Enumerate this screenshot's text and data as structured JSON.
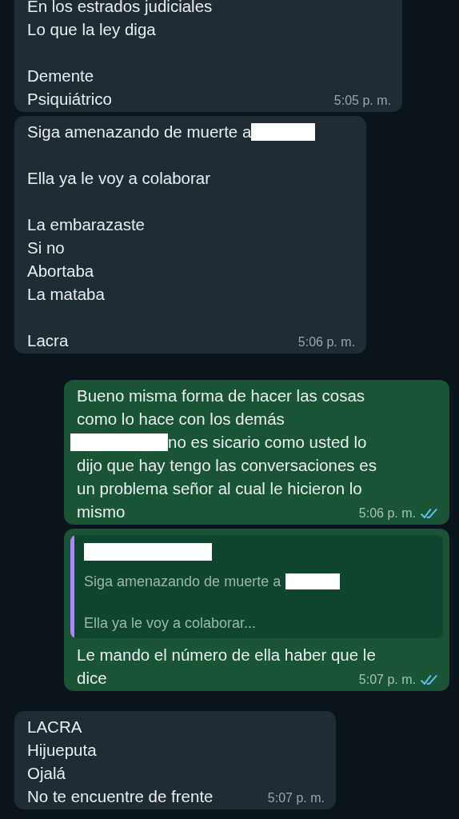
{
  "messages": [
    {
      "kind": "incoming",
      "paragraphs": [
        [
          {
            "text": "En los estrados judiciales"
          },
          {
            "text": "Lo que la ley diga"
          }
        ],
        [
          {
            "text": "Demente"
          },
          {
            "text": "Psiquiátrico"
          }
        ]
      ],
      "time": "5:05 p. m."
    },
    {
      "kind": "incoming",
      "paragraphs": [
        [
          {
            "text": "Siga amenazando de muerte a",
            "redacted_after": true
          }
        ],
        [
          {
            "text": "Ella ya le voy a colaborar"
          }
        ],
        [
          {
            "text": "La embarazaste"
          },
          {
            "text": "Si no"
          },
          {
            "text": "Abortaba"
          },
          {
            "text": "La mataba"
          }
        ],
        [
          {
            "text": "Lacra"
          }
        ]
      ],
      "time": "5:06 p. m."
    },
    {
      "kind": "outgoing",
      "paragraphs": [
        [
          {
            "text": "Bueno misma forma de hacer las cosas"
          },
          {
            "text": "como lo hace con los demás"
          },
          {
            "text": "no es sicario como usted lo",
            "redacted_before": true
          },
          {
            "text": "dijo que hay tengo las conversaciones es"
          },
          {
            "text": "un problema señor al cual le hicieron lo"
          },
          {
            "text": "mismo"
          }
        ]
      ],
      "time": "5:06 p. m.",
      "read": true
    },
    {
      "kind": "outgoing",
      "quote": {
        "author_hidden": true,
        "paragraphs": [
          [
            {
              "text": "Siga amenazando de muerte a",
              "redacted_after": true
            }
          ],
          [
            {
              "text": "Ella ya le voy a colaborar..."
            }
          ]
        ]
      },
      "paragraphs": [
        [
          {
            "text": "Le mando el número de ella haber que le"
          },
          {
            "text": "dice"
          }
        ]
      ],
      "time": "5:07 p. m.",
      "read": true
    },
    {
      "kind": "incoming",
      "paragraphs": [
        [
          {
            "text": "LACRA"
          },
          {
            "text": "Hijueputa"
          },
          {
            "text": "Ojalá"
          },
          {
            "text": "No te encuentre de frente"
          }
        ]
      ],
      "time": "5:07 p. m."
    }
  ]
}
